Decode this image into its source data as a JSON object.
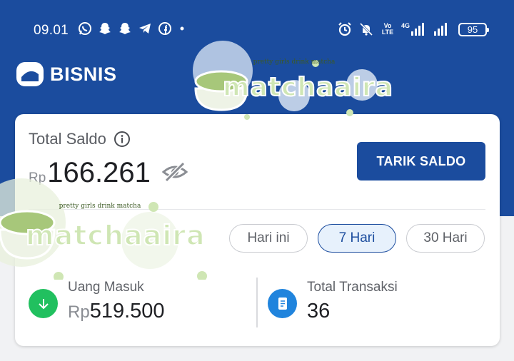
{
  "status_bar": {
    "time": "09.01",
    "app_icons": [
      "whatsapp-icon",
      "snapchat-icon",
      "snapchat-icon",
      "telegram-icon",
      "facebook-icon",
      "dot-icon"
    ],
    "network_label_1": "Vo LTE",
    "network_label_2": "4G",
    "battery": "95"
  },
  "brand": {
    "name": "BISNIS"
  },
  "balance": {
    "label": "Total Saldo",
    "currency": "Rp",
    "amount": "166.261",
    "withdraw_label": "TARIK SALDO"
  },
  "filters": [
    {
      "label": "Hari ini",
      "active": false
    },
    {
      "label": "7 Hari",
      "active": true
    },
    {
      "label": "30 Hari",
      "active": false
    }
  ],
  "stats": {
    "money_in": {
      "label": "Uang Masuk",
      "currency": "Rp",
      "value": "519.500"
    },
    "transactions": {
      "label": "Total Transaksi",
      "value": "36"
    }
  },
  "sticker": {
    "word": "matchaaira",
    "tagline": "pretty girls drink matcha"
  },
  "colors": {
    "primary": "#1b4c9e",
    "money_in": "#21c05f",
    "transactions": "#2084dd"
  }
}
